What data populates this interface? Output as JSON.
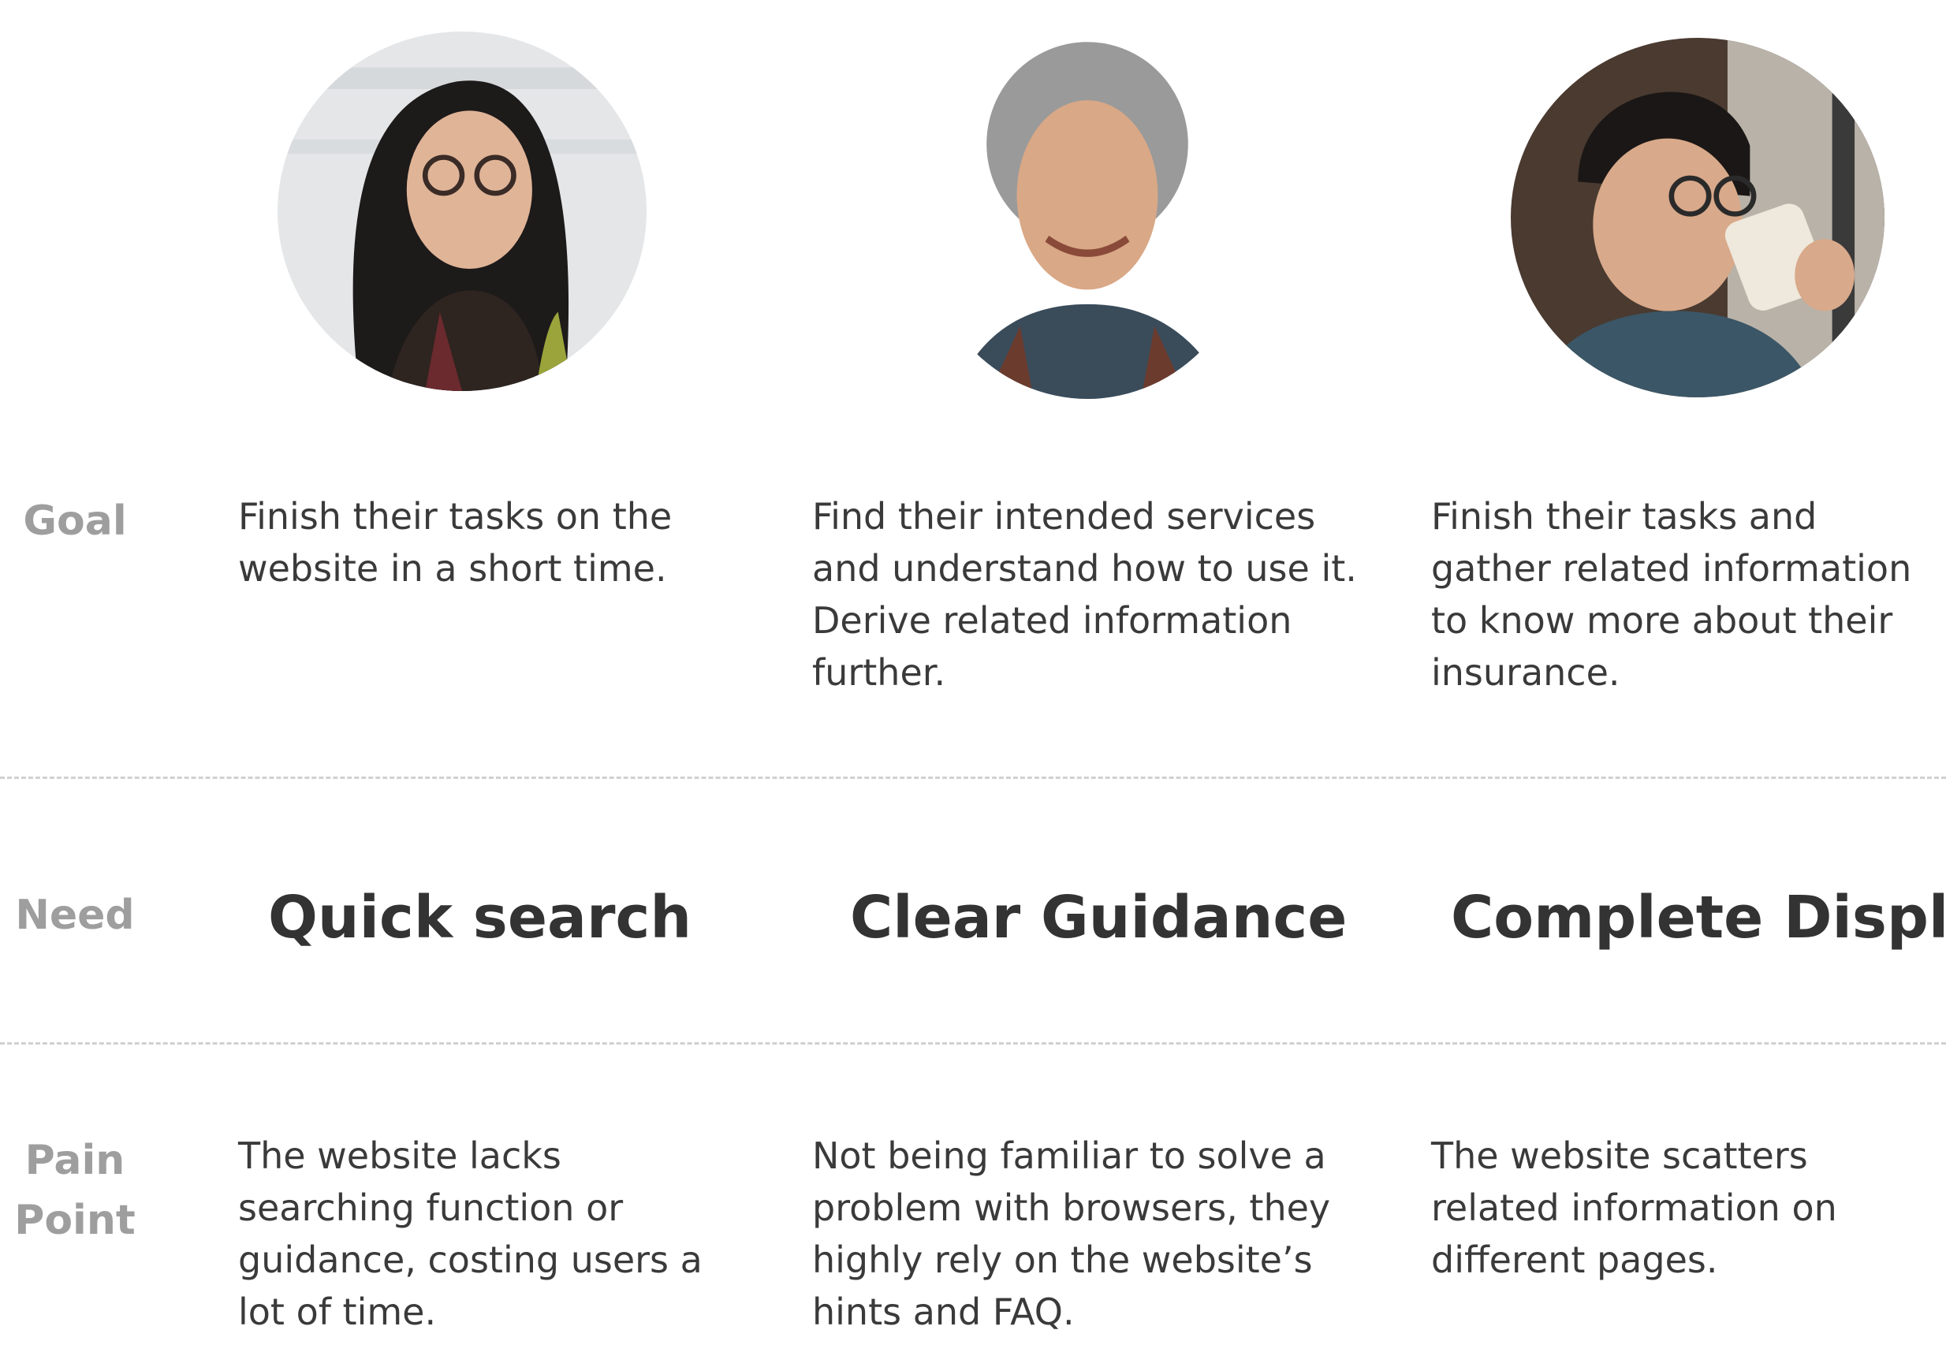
{
  "personas": [
    {
      "photo_icon": "young-woman-with-glasses-photo",
      "goal": "Finish their tasks on the website in a short time.",
      "need": "Quick search",
      "pain_point": "The website lacks searching function or guidance, costing users a lot of time."
    },
    {
      "photo_icon": "older-woman-smiling-photo",
      "goal": "Find their intended services and understand how to use it. Derive related information further.",
      "need": "Clear Guidance",
      "pain_point": "Not being familiar to solve a problem with browsers, they highly rely on the website’s hints and FAQ."
    },
    {
      "photo_icon": "young-man-drinking-coffee-photo",
      "goal": "Finish their tasks and gather related information to know more about their insurance.",
      "need": "Complete Display",
      "pain_point": "The website scatters related information on different pages."
    }
  ],
  "row_labels": {
    "goal": "Goal",
    "need": "Need",
    "pain_point": "Pain Point"
  },
  "colors": {
    "label_gray": "#9e9e9e",
    "text_dark": "#333333",
    "divider": "#d0d0d0"
  }
}
